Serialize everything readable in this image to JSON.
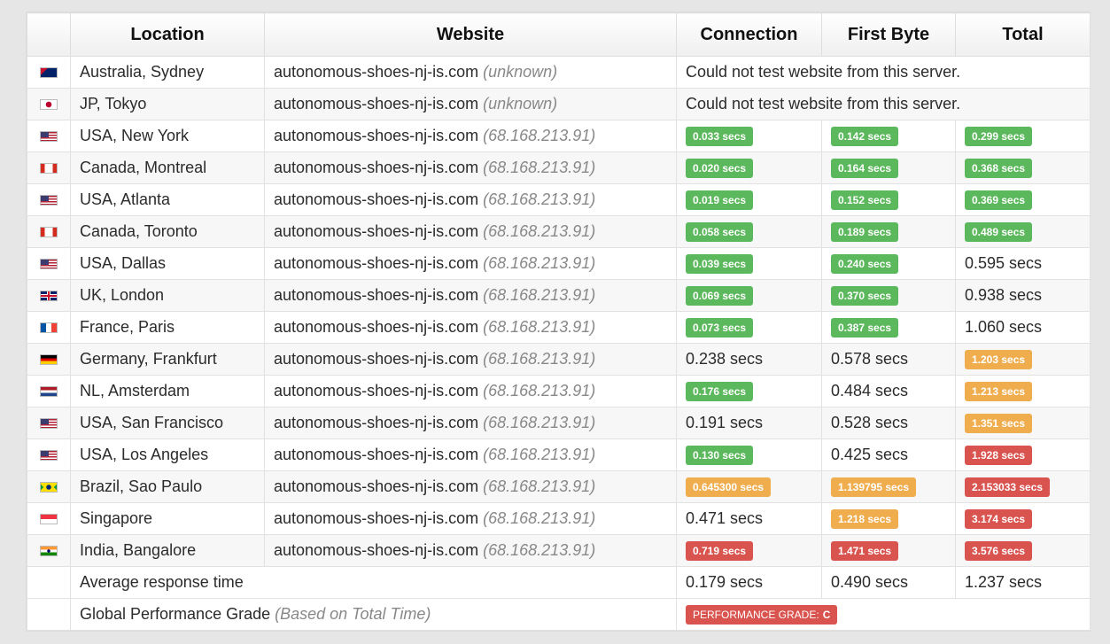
{
  "headers": {
    "location": "Location",
    "website": "Website",
    "connection": "Connection",
    "first_byte": "First Byte",
    "total": "Total"
  },
  "colors": {
    "green": "#5cb85c",
    "orange": "#f0ad4e",
    "red": "#d9534f"
  },
  "rows": [
    {
      "flag": "AU",
      "location": "Australia, Sydney",
      "site": "autonomous-shoes-nj-is.com",
      "ip": "(unknown)",
      "error": "Could not test website from this server."
    },
    {
      "flag": "JP",
      "location": "JP, Tokyo",
      "site": "autonomous-shoes-nj-is.com",
      "ip": "(unknown)",
      "error": "Could not test website from this server."
    },
    {
      "flag": "US",
      "location": "USA, New York",
      "site": "autonomous-shoes-nj-is.com",
      "ip": "(68.168.213.91)",
      "conn": {
        "text": "0.033 secs",
        "status": "green"
      },
      "fb": {
        "text": "0.142 secs",
        "status": "green"
      },
      "total": {
        "text": "0.299 secs",
        "status": "green"
      }
    },
    {
      "flag": "CA",
      "location": "Canada, Montreal",
      "site": "autonomous-shoes-nj-is.com",
      "ip": "(68.168.213.91)",
      "conn": {
        "text": "0.020 secs",
        "status": "green"
      },
      "fb": {
        "text": "0.164 secs",
        "status": "green"
      },
      "total": {
        "text": "0.368 secs",
        "status": "green"
      }
    },
    {
      "flag": "US",
      "location": "USA, Atlanta",
      "site": "autonomous-shoes-nj-is.com",
      "ip": "(68.168.213.91)",
      "conn": {
        "text": "0.019 secs",
        "status": "green"
      },
      "fb": {
        "text": "0.152 secs",
        "status": "green"
      },
      "total": {
        "text": "0.369 secs",
        "status": "green"
      }
    },
    {
      "flag": "CA",
      "location": "Canada, Toronto",
      "site": "autonomous-shoes-nj-is.com",
      "ip": "(68.168.213.91)",
      "conn": {
        "text": "0.058 secs",
        "status": "green"
      },
      "fb": {
        "text": "0.189 secs",
        "status": "green"
      },
      "total": {
        "text": "0.489 secs",
        "status": "green"
      }
    },
    {
      "flag": "US",
      "location": "USA, Dallas",
      "site": "autonomous-shoes-nj-is.com",
      "ip": "(68.168.213.91)",
      "conn": {
        "text": "0.039 secs",
        "status": "green"
      },
      "fb": {
        "text": "0.240 secs",
        "status": "green"
      },
      "total": {
        "text": "0.595 secs",
        "status": "plain"
      }
    },
    {
      "flag": "GB",
      "location": "UK, London",
      "site": "autonomous-shoes-nj-is.com",
      "ip": "(68.168.213.91)",
      "conn": {
        "text": "0.069 secs",
        "status": "green"
      },
      "fb": {
        "text": "0.370 secs",
        "status": "green"
      },
      "total": {
        "text": "0.938 secs",
        "status": "plain"
      }
    },
    {
      "flag": "FR",
      "location": "France, Paris",
      "site": "autonomous-shoes-nj-is.com",
      "ip": "(68.168.213.91)",
      "conn": {
        "text": "0.073 secs",
        "status": "green"
      },
      "fb": {
        "text": "0.387 secs",
        "status": "green"
      },
      "total": {
        "text": "1.060 secs",
        "status": "plain"
      }
    },
    {
      "flag": "DE",
      "location": "Germany, Frankfurt",
      "site": "autonomous-shoes-nj-is.com",
      "ip": "(68.168.213.91)",
      "conn": {
        "text": "0.238 secs",
        "status": "plain"
      },
      "fb": {
        "text": "0.578 secs",
        "status": "plain"
      },
      "total": {
        "text": "1.203 secs",
        "status": "orange"
      }
    },
    {
      "flag": "NL",
      "location": "NL, Amsterdam",
      "site": "autonomous-shoes-nj-is.com",
      "ip": "(68.168.213.91)",
      "conn": {
        "text": "0.176 secs",
        "status": "green"
      },
      "fb": {
        "text": "0.484 secs",
        "status": "plain"
      },
      "total": {
        "text": "1.213 secs",
        "status": "orange"
      }
    },
    {
      "flag": "US",
      "location": "USA, San Francisco",
      "site": "autonomous-shoes-nj-is.com",
      "ip": "(68.168.213.91)",
      "conn": {
        "text": "0.191 secs",
        "status": "plain"
      },
      "fb": {
        "text": "0.528 secs",
        "status": "plain"
      },
      "total": {
        "text": "1.351 secs",
        "status": "orange"
      }
    },
    {
      "flag": "US",
      "location": "USA, Los Angeles",
      "site": "autonomous-shoes-nj-is.com",
      "ip": "(68.168.213.91)",
      "conn": {
        "text": "0.130 secs",
        "status": "green"
      },
      "fb": {
        "text": "0.425 secs",
        "status": "plain"
      },
      "total": {
        "text": "1.928 secs",
        "status": "red"
      }
    },
    {
      "flag": "BR",
      "location": "Brazil, Sao Paulo",
      "site": "autonomous-shoes-nj-is.com",
      "ip": "(68.168.213.91)",
      "conn": {
        "text": "0.645300 secs",
        "status": "orange"
      },
      "fb": {
        "text": "1.139795 secs",
        "status": "orange"
      },
      "total": {
        "text": "2.153033 secs",
        "status": "red"
      }
    },
    {
      "flag": "SG",
      "location": "Singapore",
      "site": "autonomous-shoes-nj-is.com",
      "ip": "(68.168.213.91)",
      "conn": {
        "text": "0.471 secs",
        "status": "plain"
      },
      "fb": {
        "text": "1.218 secs",
        "status": "orange"
      },
      "total": {
        "text": "3.174 secs",
        "status": "red"
      }
    },
    {
      "flag": "IN",
      "location": "India, Bangalore",
      "site": "autonomous-shoes-nj-is.com",
      "ip": "(68.168.213.91)",
      "conn": {
        "text": "0.719 secs",
        "status": "red"
      },
      "fb": {
        "text": "1.471 secs",
        "status": "red"
      },
      "total": {
        "text": "3.576 secs",
        "status": "red"
      }
    }
  ],
  "average": {
    "label": "Average response time",
    "conn": "0.179 secs",
    "fb": "0.490 secs",
    "total": "1.237 secs"
  },
  "grade": {
    "label": "Global Performance Grade",
    "note": "(Based on Total Time)",
    "badge_label": "PERFORMANCE GRADE:",
    "value": "C"
  }
}
